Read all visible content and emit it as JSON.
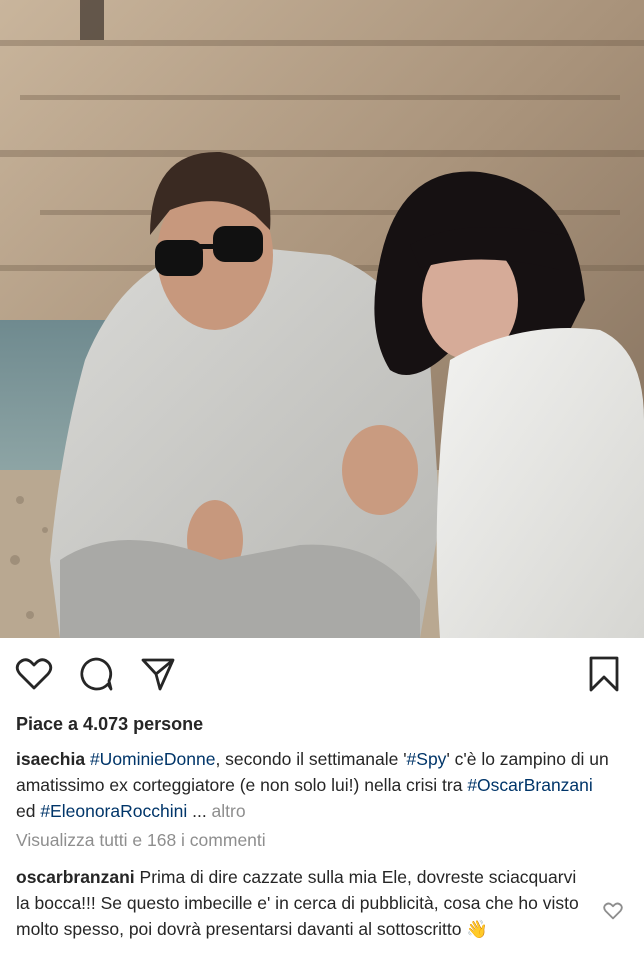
{
  "post": {
    "likes_text": "Piace a 4.073 persone",
    "caption": {
      "username": "isaechia",
      "segments": [
        {
          "text": " ",
          "kind": "plain"
        },
        {
          "text": "#UominieDonne",
          "kind": "tag"
        },
        {
          "text": ", secondo il settimanale '",
          "kind": "plain"
        },
        {
          "text": "#Spy",
          "kind": "tag"
        },
        {
          "text": "' c'è lo zampino di un amatissimo ex corteggiatore (e non solo lui!) nella crisi tra ",
          "kind": "plain"
        },
        {
          "text": "#OscarBranzani",
          "kind": "tag"
        },
        {
          "text": " ed ",
          "kind": "plain"
        },
        {
          "text": "#EleonoraRocchini",
          "kind": "tag"
        },
        {
          "text": " ... ",
          "kind": "plain"
        }
      ],
      "more_label": "altro"
    },
    "view_comments_text": "Visualizza tutti e 168 i commenti",
    "comment": {
      "username": "oscarbranzani",
      "text": " Prima di dire cazzate sulla mia Ele, dovreste sciacquarvi la bocca!!! Se questo imbecille e' in cerca di pubblicità, cosa che ho visto molto spesso, poi dovrà presentarsi davanti al sottoscritto 👋"
    }
  },
  "icons": {
    "like": "heart-icon",
    "comment": "comment-bubble-icon",
    "share": "paper-plane-icon",
    "save": "bookmark-icon",
    "comment_like": "small-heart-icon"
  },
  "colors": {
    "text": "#262626",
    "hashtag": "#003569",
    "muted": "#8e8e8e"
  }
}
